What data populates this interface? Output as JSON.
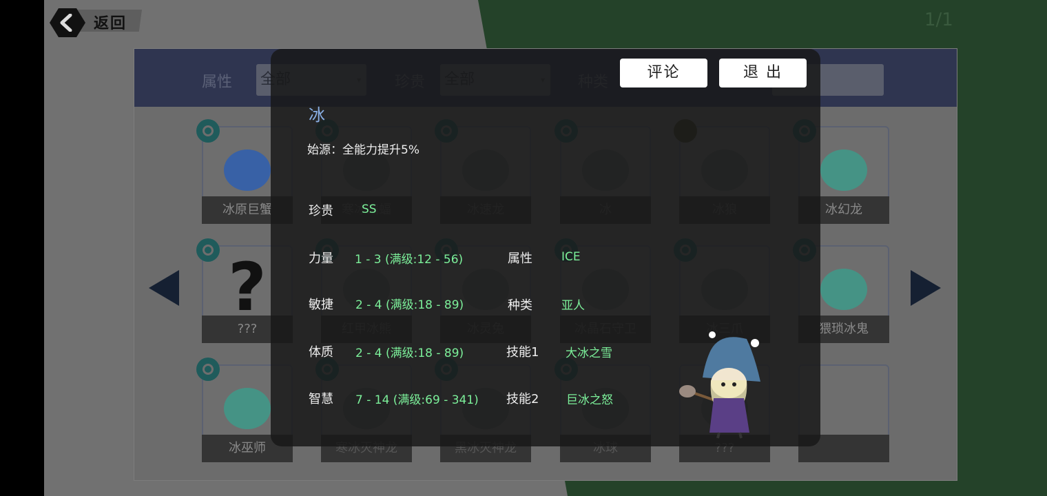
{
  "header": {
    "back_label": "返回",
    "page_indicator": "1/1"
  },
  "filters": [
    {
      "label": "属性",
      "value": "全部"
    },
    {
      "label": "珍贵",
      "value": "全部"
    },
    {
      "label": "种类",
      "value": ""
    }
  ],
  "cards": [
    {
      "name": "冰原巨蟹",
      "badge": "ring"
    },
    {
      "name": "寒冰蝙蝠",
      "badge": "ring"
    },
    {
      "name": "冰速龙",
      "badge": "ring"
    },
    {
      "name": "冰",
      "badge": "ring"
    },
    {
      "name": "冰狼",
      "badge": "bolt"
    },
    {
      "name": "冰幻龙",
      "badge": "ring"
    },
    {
      "name": "???",
      "badge": "ring"
    },
    {
      "name": "红甲冰熊",
      "badge": "ring"
    },
    {
      "name": "冰灵兔",
      "badge": "ring"
    },
    {
      "name": "冰晶石守卫",
      "badge": "ring"
    },
    {
      "name": "冰三爪",
      "badge": "ring"
    },
    {
      "name": "猥琐冰鬼",
      "badge": "ring"
    },
    {
      "name": "冰巫师",
      "badge": "ring"
    },
    {
      "name": "寒冰灭神龙",
      "badge": "ring"
    },
    {
      "name": "黑冰灭神龙",
      "badge": "ring"
    },
    {
      "name": "冰球",
      "badge": "ring"
    },
    {
      "name": "???",
      "badge": "none"
    },
    {
      "name": "",
      "badge": "none"
    }
  ],
  "popup": {
    "comment_label": "评论",
    "exit_label": "退 出",
    "title": "冰",
    "origin": "始源：全能力提升5%",
    "rarity_label": "珍贵",
    "rarity_value": "SS",
    "strength_label": "力量",
    "strength_value": "1 - 3 (满级:12 - 56)",
    "agility_label": "敏捷",
    "agility_value": "2 - 4 (满级:18 - 89)",
    "constitution_label": "体质",
    "constitution_value": "2 - 4 (满级:18 - 89)",
    "wisdom_label": "智慧",
    "wisdom_value": "7 - 14 (满级:69 - 341)",
    "attribute_label": "属性",
    "attribute_value": "ICE",
    "type_label": "种类",
    "type_value": "亚人",
    "skill1_label": "技能1",
    "skill1_value": "大冰之雪",
    "skill2_label": "技能2",
    "skill2_value": "巨冰之怒"
  },
  "colors": {
    "accent_green": "#7cf09a",
    "title_blue": "#8ab0e6",
    "filter_bar": "#2f3550",
    "bg_green": "#244229"
  }
}
